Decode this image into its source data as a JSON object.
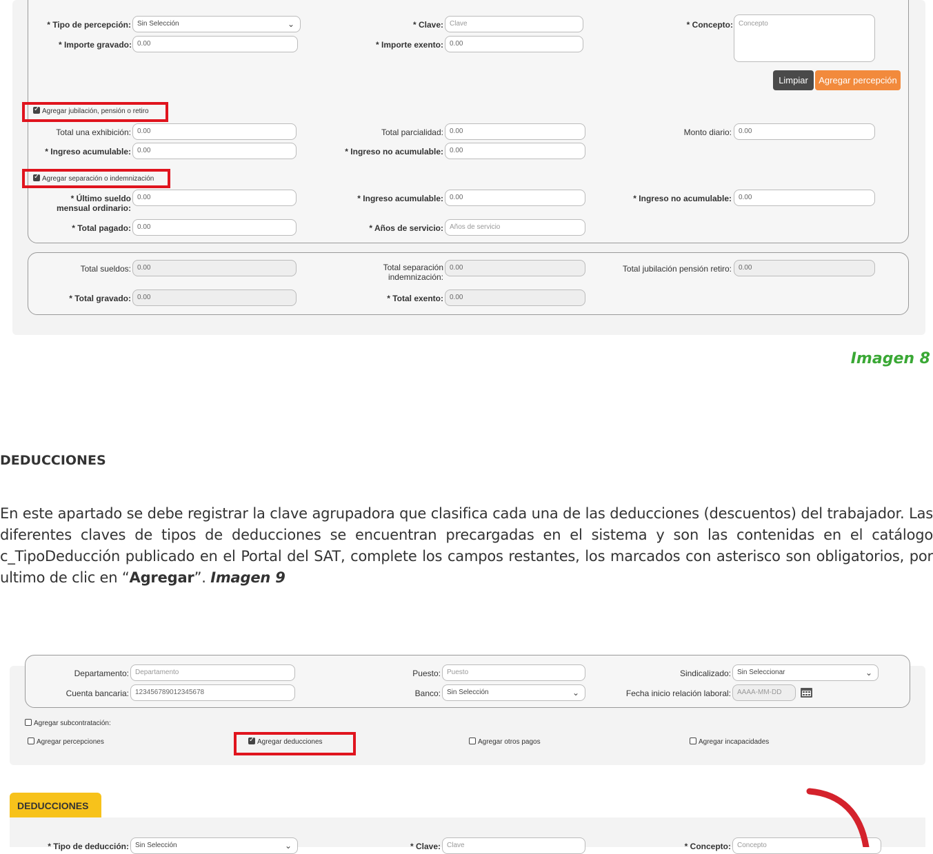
{
  "top_form": {
    "tipo_percepcion": {
      "label": "* Tipo de percepción:",
      "value": "Sin Selección"
    },
    "clave": {
      "label": "* Clave:",
      "placeholder": "Clave"
    },
    "concepto": {
      "label": "* Concepto:",
      "placeholder": "Concepto"
    },
    "importe_gravado": {
      "label": "* Importe gravado:",
      "value": "0.00"
    },
    "importe_exento": {
      "label": "* Importe exento:",
      "value": "0.00"
    },
    "btn_limpiar": "Limpiar",
    "btn_agregar_percepcion": "Agregar percepción",
    "cb_jubilacion": "Agregar jubilación, pensión o retiro",
    "total_una_exhibicion": {
      "label": "Total una exhibición:",
      "value": "0.00"
    },
    "total_parcialidad": {
      "label": "Total parcialidad:",
      "value": "0.00"
    },
    "monto_diario": {
      "label": "Monto diario:",
      "value": "0.00"
    },
    "ingreso_acumulable_1": {
      "label": "* Ingreso acumulable:",
      "value": "0.00"
    },
    "ingreso_no_acumulable_1": {
      "label": "* Ingreso no acumulable:",
      "value": "0.00"
    },
    "cb_separacion": "Agregar separación o indemnización",
    "ultimo_sueldo": {
      "label": "* Último sueldo mensual ordinario:",
      "value": "0.00"
    },
    "ingreso_acumulable_2": {
      "label": "* Ingreso acumulable:",
      "value": "0.00"
    },
    "ingreso_no_acumulable_2": {
      "label": "* Ingreso no acumulable:",
      "value": "0.00"
    },
    "total_pagado": {
      "label": "* Total pagado:",
      "value": "0.00"
    },
    "anos_servicio": {
      "label": "* Años de servicio:",
      "placeholder": "Años de servicio"
    },
    "total_sueldos": {
      "label": "Total sueldos:",
      "value": "0.00"
    },
    "total_separacion": {
      "label": "Total separación indemnización:",
      "value": "0.00"
    },
    "total_jubilacion": {
      "label": "Total jubilación pensión retiro:",
      "value": "0.00"
    },
    "total_gravado": {
      "label": "* Total gravado:",
      "value": "0.00"
    },
    "total_exento": {
      "label": "* Total exento:",
      "value": "0.00"
    }
  },
  "caption_8": "Imagen 8",
  "section_title": "DEDUCCIONES",
  "paragraph": {
    "text": "En este apartado se debe registrar la clave agrupadora que clasifica cada una de las deducciones (descuentos) del trabajador. Las diferentes claves de tipos de deducciones se encuentran precargadas en el sistema y son las contenidas en el catálogo c_TipoDeducción publicado en el Portal del SAT, complete los campos restantes, los marcados con asterisco son obligatorios, por ultimo de clic en “",
    "bold": "Agregar",
    "after": "”. ",
    "ref": "Imagen 9"
  },
  "bottom_form": {
    "departamento": {
      "label": "Departamento:",
      "placeholder": "Departamento"
    },
    "puesto": {
      "label": "Puesto:",
      "placeholder": "Puesto"
    },
    "sindicalizado": {
      "label": "Sindicalizado:",
      "value": "Sin Seleccionar"
    },
    "cuenta_bancaria": {
      "label": "Cuenta bancaria:",
      "value": "123456789012345678"
    },
    "banco": {
      "label": "Banco:",
      "value": "Sin Selección"
    },
    "fecha_inicio": {
      "label": "Fecha inicio relación laboral:",
      "placeholder": "AAAA-MM-DD"
    },
    "cb_subcontratacion": "Agregar subcontratación:",
    "cb_percepciones": "Agregar percepciones",
    "cb_deducciones": "Agregar deducciones",
    "cb_otros_pagos": "Agregar otros pagos",
    "cb_incapacidades": "Agregar incapacidades",
    "tab_deducciones": "DEDUCCIONES",
    "tipo_deduccion": {
      "label": "* Tipo de deducción:",
      "value": "Sin Selección"
    },
    "clave": {
      "label": "* Clave:",
      "placeholder": "Clave"
    },
    "concepto": {
      "label": "* Concepto:",
      "placeholder": "Concepto"
    }
  },
  "colors": {
    "accent_orange": "#f28a3c",
    "dark_button": "#4a4a4a",
    "highlight_red": "#e0141e",
    "caption_green": "#3aa835",
    "tab_yellow": "#f7c21b",
    "arrow_red": "#d4222c"
  }
}
